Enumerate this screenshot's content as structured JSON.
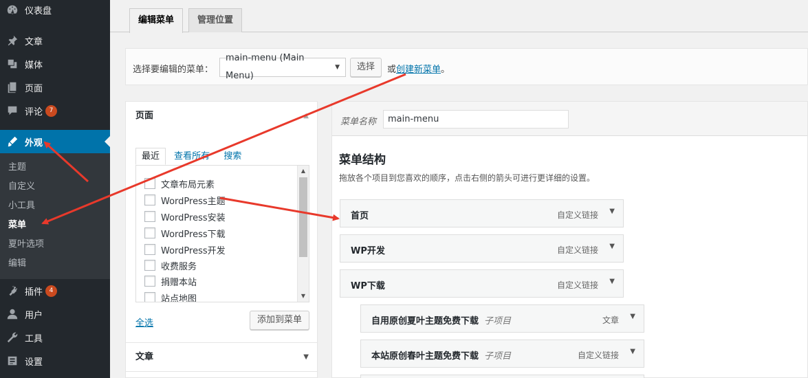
{
  "sidebar": {
    "items": [
      {
        "label": "仪表盘",
        "icon": "dashboard-icon"
      },
      {
        "label": "文章",
        "icon": "pin-icon"
      },
      {
        "label": "媒体",
        "icon": "media-icon"
      },
      {
        "label": "页面",
        "icon": "page-icon"
      },
      {
        "label": "评论",
        "icon": "comment-icon",
        "badge": "7"
      },
      {
        "label": "外观",
        "icon": "brush-icon"
      },
      {
        "label": "插件",
        "icon": "plugin-icon",
        "badge": "4"
      },
      {
        "label": "用户",
        "icon": "user-icon"
      },
      {
        "label": "工具",
        "icon": "wrench-icon"
      },
      {
        "label": "设置",
        "icon": "settings-icon"
      }
    ],
    "submenu": [
      "主题",
      "自定义",
      "小工具",
      "菜单",
      "夏叶选项",
      "编辑"
    ]
  },
  "tabs": [
    "编辑菜单",
    "管理位置"
  ],
  "select_bar": {
    "label": "选择要编辑的菜单：",
    "selected": "main-menu (Main Menu)",
    "choose_button": "选择",
    "or_text": "或",
    "create_link": "创建新菜单",
    "period": "。"
  },
  "left": {
    "pages_title": "页面",
    "tabs": [
      "最近",
      "查看所有",
      "搜索"
    ],
    "pages": [
      "文章布局元素",
      "WordPress主题",
      "WordPress安装",
      "WordPress下载",
      "WordPress开发",
      "收费服务",
      "捐赠本站",
      "站点地图"
    ],
    "select_all": "全选",
    "add_button": "添加到菜单",
    "posts_title": "文章"
  },
  "right": {
    "name_label": "菜单名称",
    "name_value": "main-menu",
    "structure_title": "菜单结构",
    "structure_desc": "拖放各个项目到您喜欢的顺序，点击右侧的箭头可进行更详细的设置。",
    "items": [
      {
        "title": "首页",
        "sub": "",
        "type": "自定义链接"
      },
      {
        "title": "WP开发",
        "sub": "",
        "type": "自定义链接"
      },
      {
        "title": "WP下载",
        "sub": "",
        "type": "自定义链接"
      },
      {
        "title": "自用原创夏叶主题免费下载",
        "sub": "子项目",
        "type": "文章"
      },
      {
        "title": "本站原创春叶主题免费下载",
        "sub": "子项目",
        "type": "自定义链接"
      }
    ]
  },
  "colors": {
    "accent": "#0073aa",
    "sidebar": "#23282d",
    "annotation": "#e8392b"
  }
}
